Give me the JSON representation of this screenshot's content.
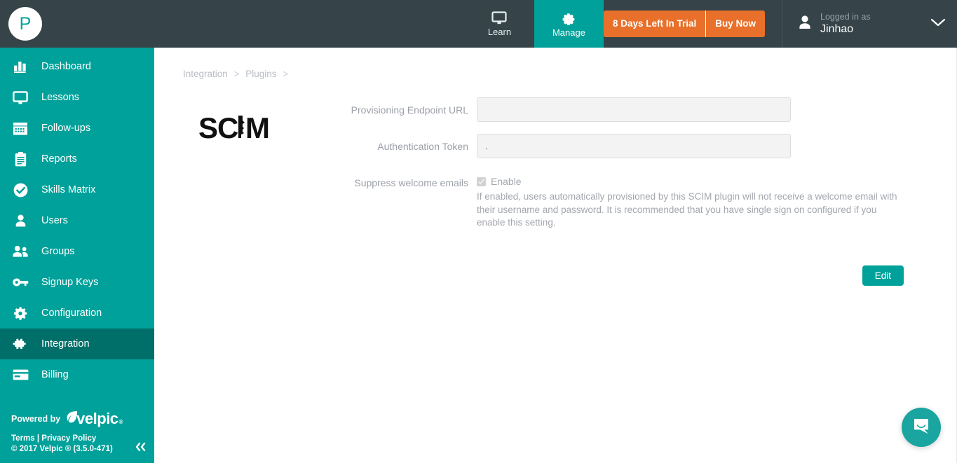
{
  "header": {
    "brand_initial": "P",
    "tabs": [
      {
        "label": "Learn",
        "icon": "monitor-icon",
        "active": false
      },
      {
        "label": "Manage",
        "icon": "gear-icon",
        "active": true
      }
    ],
    "trial": {
      "days_text": "8 Days Left In Trial",
      "buy_label": "Buy Now"
    },
    "user": {
      "logged_in_label": "Logged in as",
      "name": "Jinhao",
      "avatar_icon": "person-icon",
      "chevron_icon": "chevron-down-icon"
    }
  },
  "sidebar": {
    "items": [
      {
        "label": "Dashboard",
        "icon": "bar-chart-icon",
        "active": false
      },
      {
        "label": "Lessons",
        "icon": "monitor-icon",
        "active": false
      },
      {
        "label": "Follow-ups",
        "icon": "calendar-icon",
        "active": false
      },
      {
        "label": "Reports",
        "icon": "clipboard-icon",
        "active": false
      },
      {
        "label": "Skills Matrix",
        "icon": "check-circle-icon",
        "active": false
      },
      {
        "label": "Users",
        "icon": "person-icon",
        "active": false
      },
      {
        "label": "Groups",
        "icon": "people-icon",
        "active": false
      },
      {
        "label": "Signup Keys",
        "icon": "key-icon",
        "active": false
      },
      {
        "label": "Configuration",
        "icon": "gear-icon",
        "active": false
      },
      {
        "label": "Integration",
        "icon": "puzzle-icon",
        "active": true
      },
      {
        "label": "Billing",
        "icon": "credit-card-icon",
        "active": false
      }
    ],
    "footer": {
      "powered_by": "Powered by",
      "brand": "velpic",
      "registered_mark": "®",
      "terms": "Terms",
      "separator": "|",
      "privacy": "Privacy Policy",
      "copyright": "© 2017 Velpic ® (3.5.0-471)",
      "collapse_icon": "double-chevron-left-icon"
    }
  },
  "main": {
    "breadcrumb": [
      {
        "label": "Integration"
      },
      {
        "label": "Plugins"
      }
    ],
    "breadcrumb_separator": ">",
    "plugin": {
      "logo_text": "SCIM",
      "logo_name": "scim-logo"
    },
    "form": {
      "endpoint": {
        "label": "Provisioning Endpoint URL",
        "value": "",
        "placeholder": ""
      },
      "token": {
        "label": "Authentication Token",
        "value": ".",
        "placeholder": ""
      },
      "suppress": {
        "label": "Suppress welcome emails",
        "checkbox_label": "Enable",
        "checked": true,
        "help_text": "If enabled, users automatically provisioned by this SCIM plugin will not receive a welcome email with their username and password. It is recommended that you have single sign on configured if you enable this setting."
      },
      "edit_label": "Edit"
    }
  },
  "widgets": {
    "intercom": {
      "name": "intercom-launcher",
      "icon": "chat-bubble-icon"
    }
  },
  "colors": {
    "brand_teal": "#00a19a",
    "teal_dark": "#006f6a",
    "header_dark": "#364449",
    "trial_orange": "#e8702a",
    "muted_text": "#a3a7ae"
  }
}
